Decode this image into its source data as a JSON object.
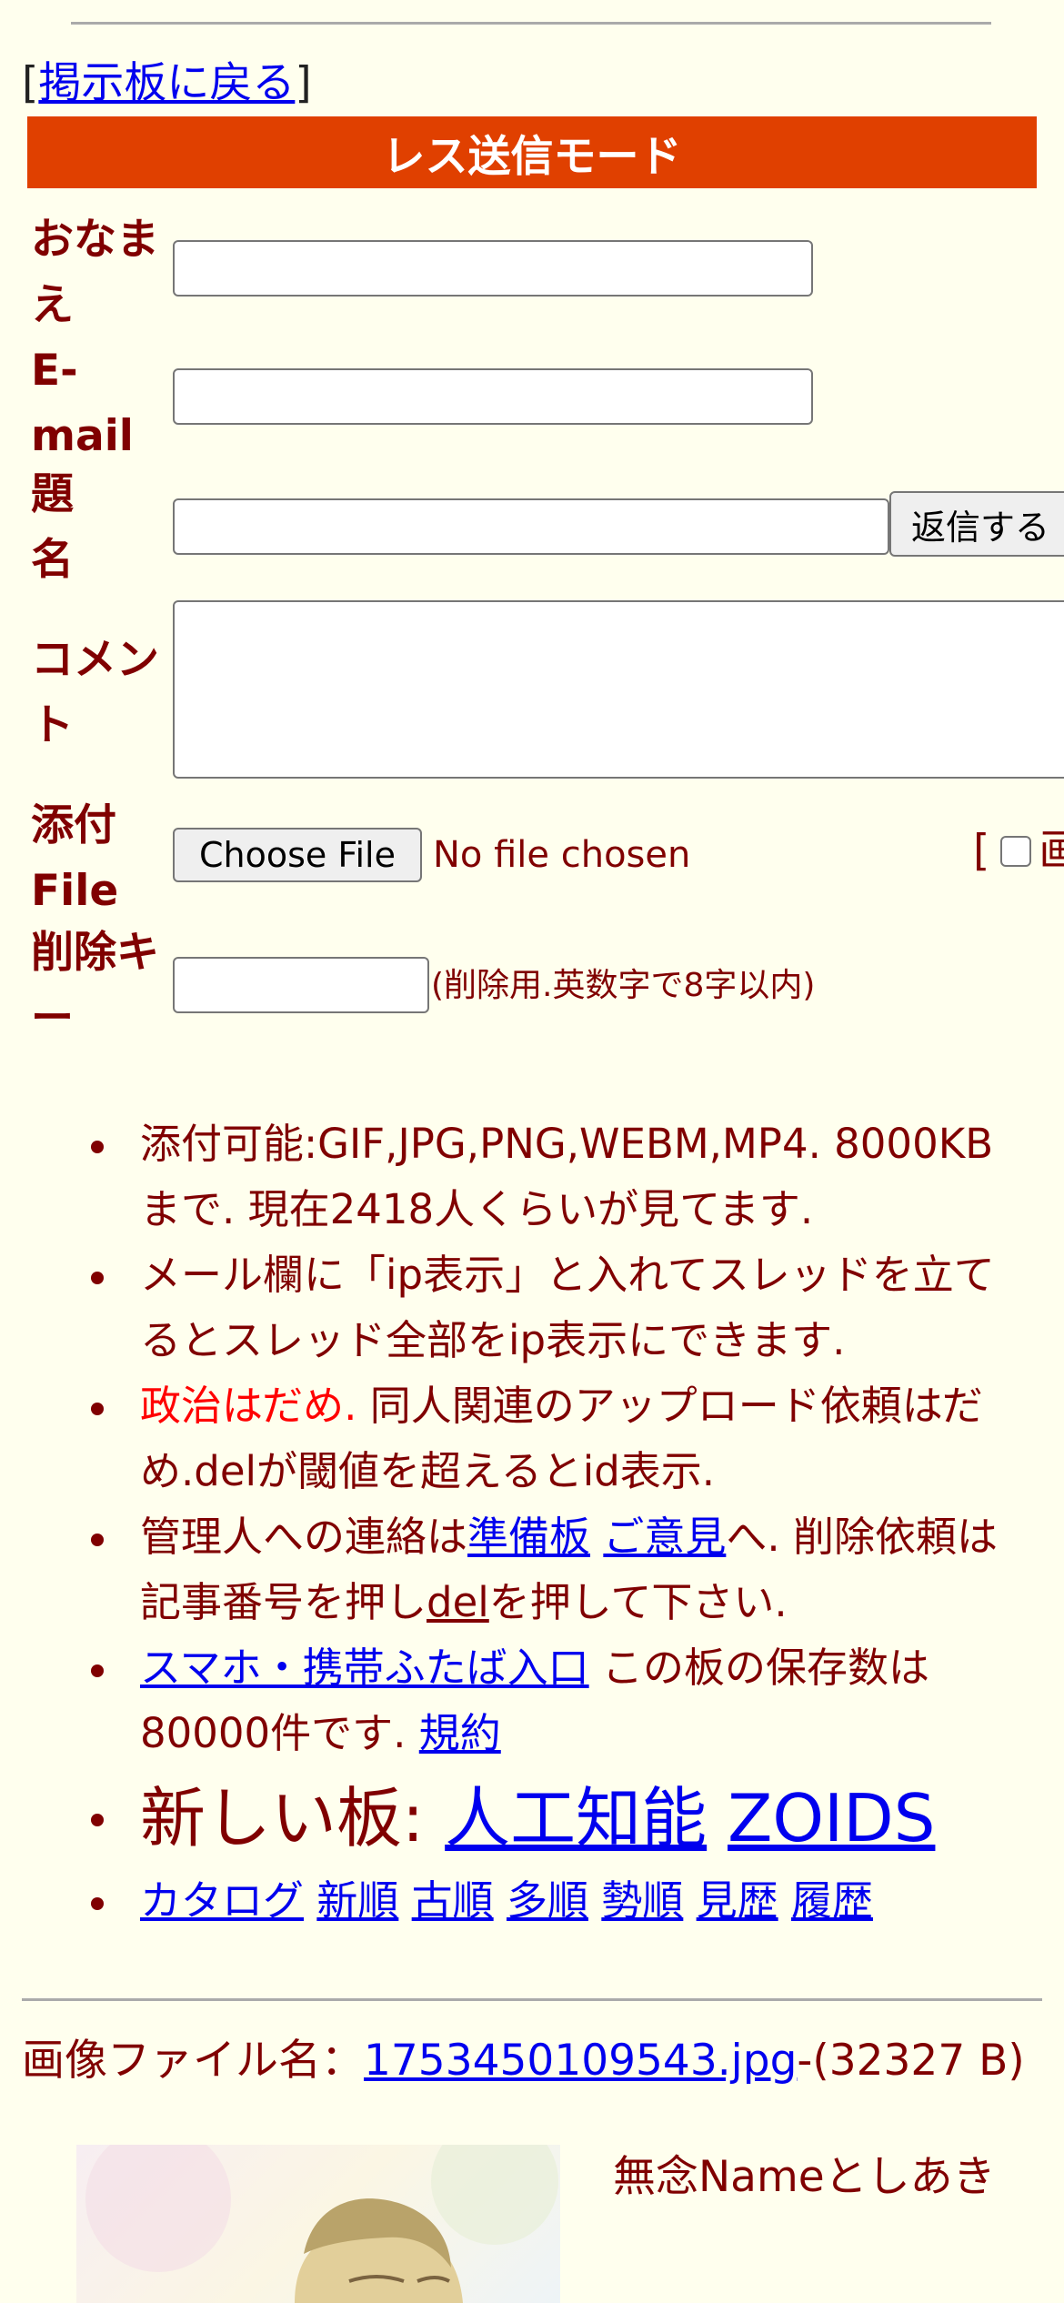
{
  "nav": {
    "bracket_open": "[",
    "back_link": "掲示板に戻る",
    "bracket_close": "]"
  },
  "mode_title": "レス送信モード",
  "form": {
    "name_label_l1": "おなま",
    "name_label_l2": "え",
    "email_label_l1": "E-",
    "email_label_l2": "mail",
    "subject_label_l1": "題",
    "subject_label_l2": "名",
    "submit_label": "返信する",
    "comment_label_l1": "コメン",
    "comment_label_l2": "ト",
    "attach_label_l1": "添付",
    "attach_label_l2": "File",
    "choose_file": "Choose File",
    "no_file": "No file chosen",
    "image_only_bracket": "[",
    "image_only_label": "画",
    "delkey_label_l1": "削除キ",
    "delkey_label_l2": "ー",
    "delkey_note": "(削除用.英数字で8字以内)"
  },
  "rules": {
    "r1": "添付可能:GIF,JPG,PNG,WEBM,MP4. 8000KBまで. 現在2418人くらいが見てます.",
    "r2": "メール欄に「ip表示」と入れてスレッドを立てるとスレッド全部をip表示にできます.",
    "r3_red": "政治はだめ.",
    "r3_rest": " 同人関連のアップロード依頼はだめ.delが閾値を超えるとid表示.",
    "r4_a": "管理人への連絡は",
    "r4_link1": "準備板",
    "r4_link2": "ご意見",
    "r4_b": "へ. 削除依頼は記事番号を押し",
    "r4_del": "del",
    "r4_c": "を押して下さい.",
    "r5_link": "スマホ・携帯ふたば入口",
    "r5_text": " この板の保存数は80000件です. ",
    "r5_terms": "規約",
    "new_boards_label": "新しい板: ",
    "new_board_1": "人工知能",
    "new_board_2": "ZOIDS",
    "sort_links": [
      "カタログ",
      "新順",
      "古順",
      "多順",
      "勢順",
      "見歴",
      "履歴"
    ]
  },
  "post": {
    "file_label": "画像ファイル名：",
    "file_link": "1753450109543.jpg",
    "file_size": "-(32327 B)",
    "name_line": "無念Nameとしあき"
  }
}
